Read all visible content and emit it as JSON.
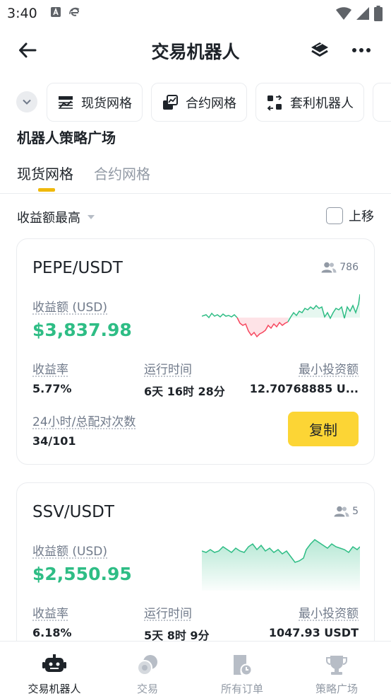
{
  "status_bar": {
    "time": "3:40"
  },
  "header": {
    "title": "交易机器人"
  },
  "chips": [
    {
      "label": "现货网格",
      "icon": "spot-grid-icon"
    },
    {
      "label": "合约网格",
      "icon": "futures-grid-icon"
    },
    {
      "label": "套利机器人",
      "icon": "arbitrage-icon"
    }
  ],
  "section": {
    "title": "机器人策略广场"
  },
  "tabs": [
    {
      "label": "现货网格",
      "active": true
    },
    {
      "label": "合约网格",
      "active": false
    }
  ],
  "sort": {
    "label": "收益额最高",
    "up_label": "上移",
    "up_checked": false
  },
  "cards": [
    {
      "pair": "PEPE/USDT",
      "users": "786",
      "profit_label": "收益额 (USD)",
      "profit_value": "$3,837.98",
      "metrics": [
        {
          "label": "收益率",
          "value": "5.77%"
        },
        {
          "label": "运行时间",
          "value": "6天 16时 28分"
        },
        {
          "label": "最小投资额",
          "value": "12.70768885 U..."
        }
      ],
      "match_label": "24小时/总配对次数",
      "match_value": "34/101",
      "copy_label": "复制"
    },
    {
      "pair": "SSV/USDT",
      "users": "5",
      "profit_label": "收益额 (USD)",
      "profit_value": "$2,550.95",
      "metrics": [
        {
          "label": "收益率",
          "value": "6.18%"
        },
        {
          "label": "运行时间",
          "value": "5天 8时 9分"
        },
        {
          "label": "最小投资额",
          "value": "1047.93 USDT"
        }
      ]
    }
  ],
  "bottom_nav": [
    {
      "label": "交易机器人",
      "icon": "robot-icon",
      "active": true
    },
    {
      "label": "交易",
      "icon": "trade-icon",
      "active": false
    },
    {
      "label": "所有订单",
      "icon": "orders-icon",
      "active": false
    },
    {
      "label": "策略广场",
      "icon": "trophy-icon",
      "active": false
    }
  ],
  "colors": {
    "accent": "#fcd535",
    "tab_indicator": "#f0b90b",
    "profit_green": "#2ebd85",
    "loss_red": "#f6465d",
    "text_primary": "#1e2329",
    "text_secondary": "#707a8a"
  }
}
